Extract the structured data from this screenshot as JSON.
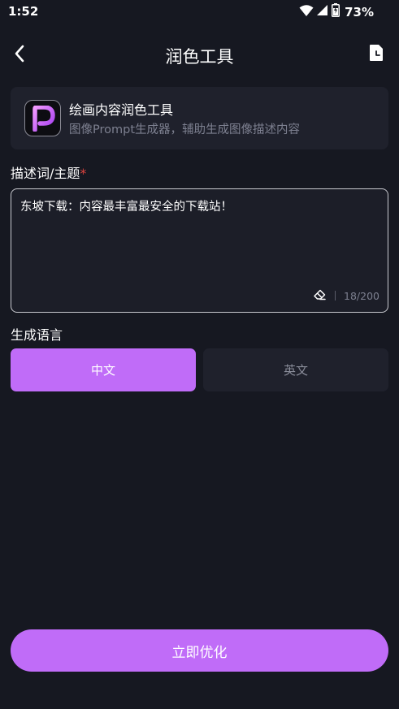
{
  "status_bar": {
    "time": "1:52",
    "battery": "73%"
  },
  "header": {
    "title": "润色工具"
  },
  "tool_card": {
    "name": "绘画内容润色工具",
    "description": "图像Prompt生成器，辅助生成图像描述内容"
  },
  "description_section": {
    "label": "描述词/主题",
    "required_mark": "*",
    "value": "东坡下载：内容最丰富最安全的下载站！",
    "char_count": "18/200"
  },
  "language_section": {
    "label": "生成语言",
    "options": [
      {
        "label": "中文",
        "selected": true
      },
      {
        "label": "英文",
        "selected": false
      }
    ]
  },
  "actions": {
    "optimize_label": "立即优化"
  },
  "colors": {
    "background": "#161821",
    "card": "#1f212c",
    "accent": "#c06cf8",
    "muted_text": "#7d8090",
    "required": "#e0443f"
  },
  "icons": {
    "back": "chevron-left-icon",
    "history": "document-clock-icon",
    "logo": "p-logo-icon",
    "eraser": "eraser-icon",
    "wifi": "wifi-icon",
    "signal": "signal-icon",
    "battery": "battery-charging-icon"
  }
}
